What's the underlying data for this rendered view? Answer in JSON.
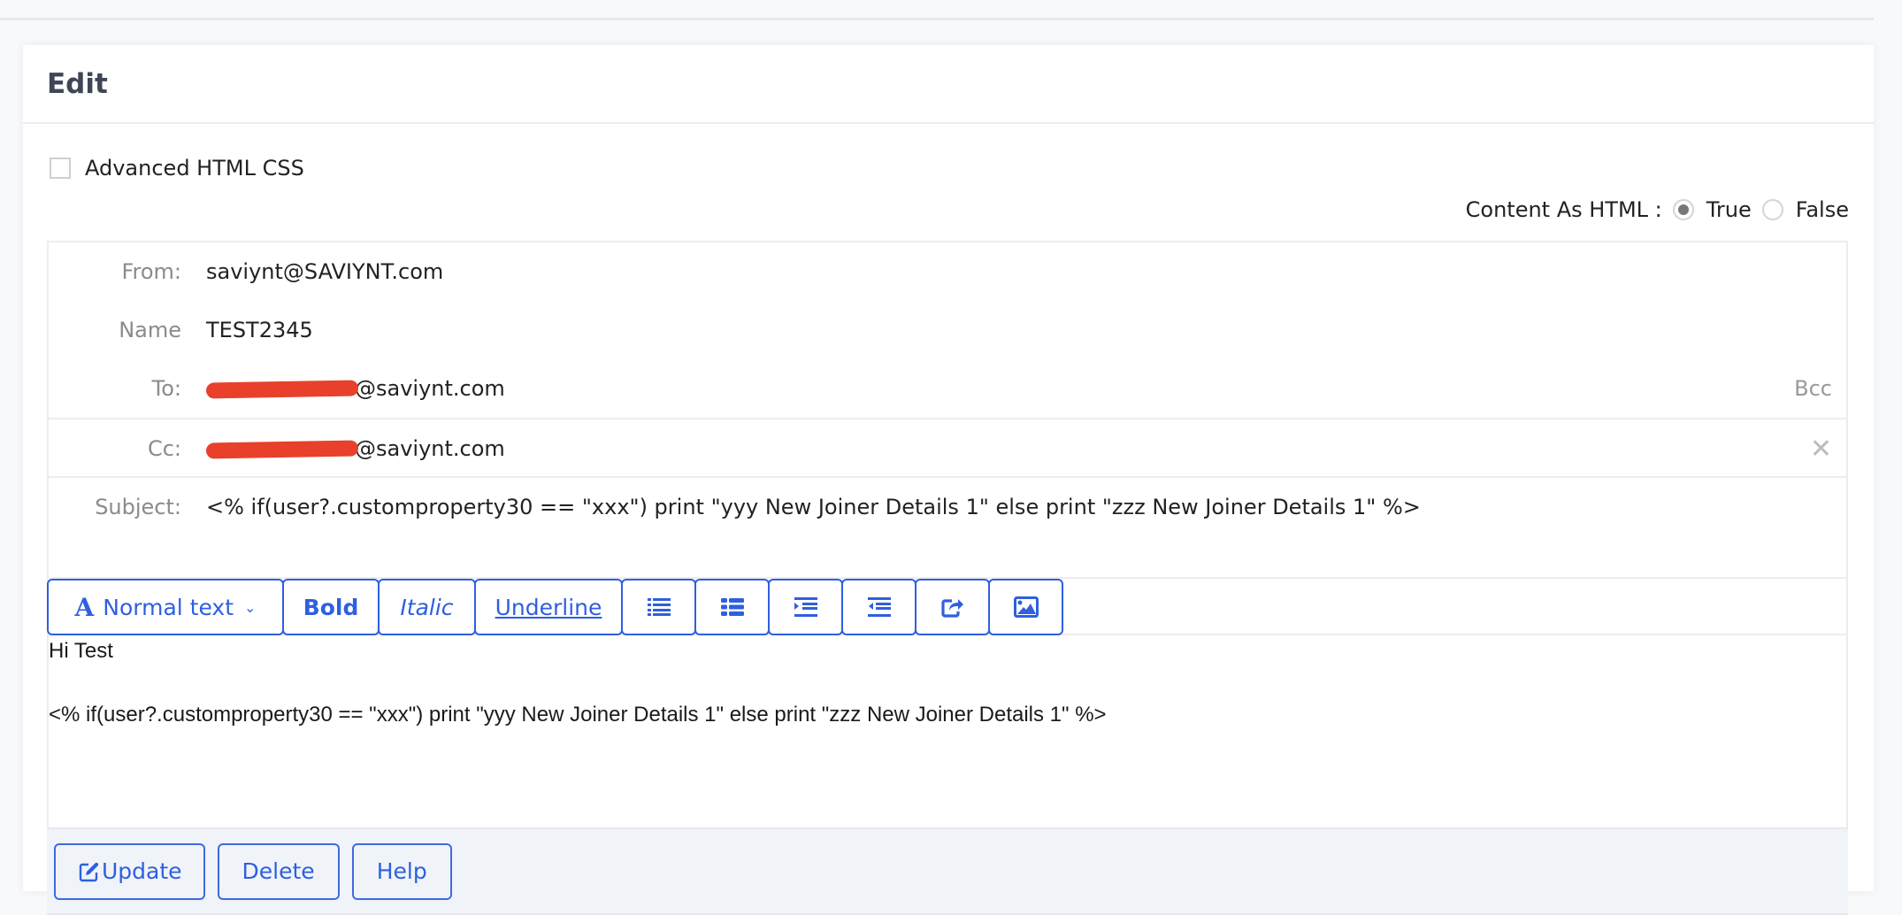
{
  "card": {
    "title": "Edit"
  },
  "advanced": {
    "label": "Advanced HTML CSS",
    "checked": false
  },
  "content_as_html": {
    "label": "Content As HTML :",
    "options": [
      {
        "label": "True",
        "selected": true
      },
      {
        "label": "False",
        "selected": false
      }
    ]
  },
  "fields": {
    "from": {
      "label": "From:",
      "value": "saviynt@SAVIYNT.com"
    },
    "name": {
      "label": "Name",
      "value": "TEST2345"
    },
    "to": {
      "label": "To:",
      "value": "@saviynt.com",
      "extra": "Bcc"
    },
    "cc": {
      "label": "Cc:",
      "value": "@saviynt.com"
    },
    "subject": {
      "label": "Subject:",
      "value": "<% if(user?.customproperty30 == \"xxx\") print \"yyy New Joiner Details 1\" else print \"zzz New Joiner Details 1\" %>"
    }
  },
  "toolbar": {
    "format": "Normal text",
    "bold": "Bold",
    "italic": "Italic",
    "underline": "Underline",
    "icons": [
      "list-ul-icon",
      "list-bullets-icon",
      "indent-icon",
      "outdent-icon",
      "share-icon",
      "image-icon"
    ]
  },
  "editor": {
    "lines": [
      "Hi Test",
      "",
      "<% if(user?.customproperty30 == \"xxx\") print \"yyy New Joiner Details 1\" else print \"zzz New Joiner Details 1\" %>"
    ]
  },
  "footer": {
    "update": "Update",
    "delete": "Delete",
    "help": "Help"
  },
  "colors": {
    "accent": "#2f5fe0",
    "redaction": "#e8402a"
  }
}
